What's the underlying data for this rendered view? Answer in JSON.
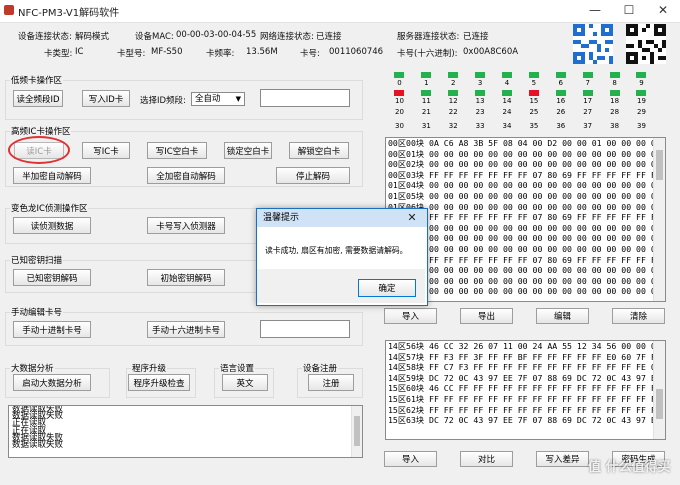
{
  "window": {
    "title": "NFC-PM3-V1解码软件",
    "minimize": "—",
    "maximize": "☐",
    "close": "✕"
  },
  "info": {
    "device_status_label": "设备连接状态:",
    "device_status_value": "解码模式",
    "device_mac_label": "设备MAC:",
    "device_mac_value": "00-00-03-00-04-55",
    "network_status_label": "网络连接状态:",
    "network_status_value": "已连接",
    "server_status_label": "服务器连接状态:",
    "server_status_value": "已连接",
    "card_type_label": "卡类型:",
    "card_type_value": "IC",
    "card_model_label": "卡型号:",
    "card_model_value": "MF-S50",
    "card_freq_label": "卡频率:",
    "card_freq_value": "13.56M",
    "card_no_label": "卡号:",
    "card_no_value": "0011060746",
    "card_no_hex_label": "卡号(十六进制):",
    "card_no_hex_value": "0x00A8C60A"
  },
  "lowfreq": {
    "title": "低频卡操作区",
    "read_band": "读全频段ID",
    "write_id": "写入ID卡",
    "select_band_label": "选择ID频段:",
    "band_select": "全自动",
    "input_value": ""
  },
  "highfreq": {
    "title": "高频IC卡操作区",
    "read_ic": "读IC卡",
    "write_ic": "写IC卡",
    "write_blank": "写IC空白卡",
    "lock_blank": "锁定空白卡",
    "unlock_blank": "解锁空白卡",
    "semi_auto": "半加密自动解码",
    "full_auto": "全加密自动解码",
    "stop": "停止解码"
  },
  "chameleon": {
    "title": "变色龙IC侦测操作区",
    "read_detect": "读侦测数据",
    "write_detector": "卡号写入侦测器"
  },
  "known_key": {
    "title": "已知密钥扫描",
    "known_decode": "已知密钥解码",
    "init_decode": "初始密钥解码"
  },
  "manual": {
    "title": "手动编辑卡号",
    "decimal": "手动十进制卡号",
    "hex": "手动十六进制卡号",
    "input_value": ""
  },
  "bigdata": {
    "title": "大数据分析",
    "start": "启动大数据分析"
  },
  "upgrade": {
    "title": "程序升级",
    "check": "程序升级检查"
  },
  "language": {
    "title": "语言设置",
    "button": "英文"
  },
  "register": {
    "title": "设备注册",
    "button": "注册"
  },
  "log": {
    "lines": [
      "数据读取失败",
      "数据读取失败",
      "正在读取",
      "正在读取",
      "数据读取失败",
      "数据读取失败"
    ]
  },
  "sectors": {
    "colors": {
      "green": "#22b14c",
      "red": "#e81123",
      "gray": "#c8c8c8"
    },
    "rows": [
      {
        "states": [
          "green",
          "green",
          "green",
          "green",
          "green",
          "green",
          "green",
          "green",
          "green",
          "green"
        ],
        "labels": [
          "0",
          "1",
          "2",
          "3",
          "4",
          "5",
          "6",
          "7",
          "8",
          "9"
        ]
      },
      {
        "states": [
          "red",
          "green",
          "green",
          "green",
          "green",
          "red",
          "green",
          "green",
          "green",
          "green"
        ],
        "labels": [
          "10",
          "11",
          "12",
          "13",
          "14",
          "15",
          "16",
          "17",
          "18",
          "19"
        ]
      },
      {
        "states": [
          "gray",
          "gray",
          "gray",
          "gray",
          "gray",
          "gray",
          "gray",
          "gray",
          "gray",
          "gray"
        ],
        "labels": [
          "20",
          "21",
          "22",
          "23",
          "24",
          "25",
          "26",
          "27",
          "28",
          "29"
        ]
      },
      {
        "states": [
          "gray",
          "gray",
          "gray",
          "gray",
          "gray",
          "gray",
          "gray",
          "gray",
          "gray",
          "gray"
        ],
        "labels": [
          "30",
          "31",
          "32",
          "33",
          "34",
          "35",
          "36",
          "37",
          "38",
          "39"
        ]
      }
    ]
  },
  "hex_top": {
    "lines": [
      "00区00块 0A C6 A8 3B 5F 08 04 00 D2 00 00 01 00 00 00 00",
      "00区01块 00 00 00 00 00 00 00 00 00 00 00 00 00 00 00 00",
      "00区02块 00 00 00 00 00 00 00 00 00 00 00 00 00 00 00 00",
      "00区03块 FF FF FF FF FF FF FF 07 80 69 FF FF FF FF FF FF",
      "01区04块 00 00 00 00 00 00 00 00 00 00 00 00 00 00 00 00",
      "01区05块 00 00 00 00 00 00 00 00 00 00 00 00 00 00 00 00",
      "01区06块 00 00 00 00 00 00 00 00 00 00 00 00 00 00 00 00",
      "01区07块 FF FF FF FF FF FF FF 07 80 69 FF FF FF FF FF FF",
      "02区08块 00 00 00 00 00 00 00 00 00 00 00 00 00 00 00 00",
      "02区09块 00 00 00 00 00 00 00 00 00 00 00 00 00 00 00 00",
      "02区10块 00 00 00 00 00 00 00 00 00 00 00 00 00 00 00 00",
      "02区11块 FF FF FF FF FF FF FF 07 80 69 FF FF FF FF FF FF",
      "03区12块 00 00 00 00 00 00 00 00 00 00 00 00 00 00 00 00",
      "03区13块 00 00 00 00 00 00 00 00 00 00 00 00 00 00 00 00",
      "03区14块 00 00 00 00 00 00 00 00 00 00 00 00 00 00 00 00"
    ]
  },
  "hex_bottom": {
    "lines": [
      "14区56块 46 CC 32 26 07 11 00 24 AA 55 12 34 56 00 00 00",
      "14区57块 FF F3 FF 3F FF FF BF FF FF FF FF FF E0 60 7F FF",
      "14区58块 FF C7 F3 FF FF FF FF FF FF FF FF FF FF FF FE 01",
      "14区59块 DC 72 0C 43 97 EE 7F 07 88 69 DC 72 0C 43 97 EE",
      "15区60块 46 CC FF FF FF FF FF FF FF FF FF FF FF FF FF FF",
      "15区61块 FF FF FF FF FF FF FF FF FF FF FF FF FF FF FF FF",
      "15区62块 FF FF FF FF FF FF FF FF FF FF FF FF FF FF FF FF",
      "15区63块 DC 72 0C 43 97 EE 7F 07 88 69 DC 72 0C 43 97 EE"
    ]
  },
  "top_actions": {
    "import": "导入",
    "export": "导出",
    "edit": "编辑",
    "clear": "清除"
  },
  "bottom_actions": {
    "import": "导入",
    "compare": "对比",
    "write_diff": "写入差异",
    "generate": "密码生成"
  },
  "dialog": {
    "title": "温馨提示",
    "message": "读卡成功, 扇区有加密, 需要数据请解码。",
    "ok": "确定",
    "close": "✕"
  },
  "watermark": "值 什么值得买"
}
